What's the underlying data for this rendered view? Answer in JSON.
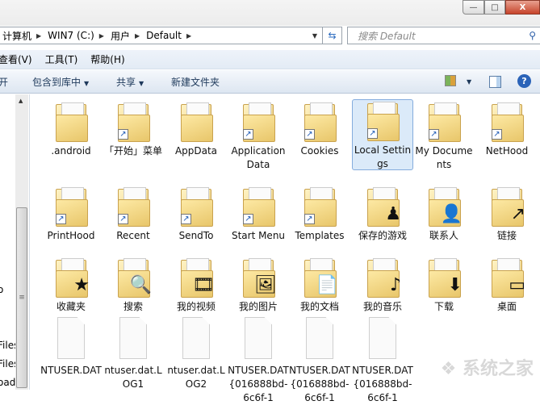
{
  "window": {
    "min": "—",
    "max": "□",
    "close": "X"
  },
  "address": {
    "crumbs": [
      "计算机",
      "WIN7 (C:)",
      "用户",
      "Default"
    ],
    "refresh_icon": "refresh-icon"
  },
  "search": {
    "placeholder": "搜索 Default",
    "icon": "🔍"
  },
  "menu": [
    "查看(V)",
    "工具(T)",
    "帮助(H)"
  ],
  "toolbar": {
    "open": "开",
    "include": "包含到库中",
    "share": "共享",
    "new_folder": "新建文件夹"
  },
  "nav": [
    "o",
    "Files",
    "Files",
    "oad"
  ],
  "items": [
    {
      "label": ".android",
      "kind": "folder"
    },
    {
      "label": "「开始」菜单",
      "kind": "shortcut"
    },
    {
      "label": "AppData",
      "kind": "folder"
    },
    {
      "label": "Application Data",
      "kind": "shortcut"
    },
    {
      "label": "Cookies",
      "kind": "shortcut"
    },
    {
      "label": "Local Settings",
      "kind": "shortcut",
      "selected": true
    },
    {
      "label": "My Documents",
      "kind": "shortcut"
    },
    {
      "label": "NetHood",
      "kind": "shortcut"
    },
    {
      "label": "PrintHood",
      "kind": "shortcut"
    },
    {
      "label": "Recent",
      "kind": "shortcut"
    },
    {
      "label": "SendTo",
      "kind": "shortcut"
    },
    {
      "label": "Start Menu",
      "kind": "shortcut"
    },
    {
      "label": "Templates",
      "kind": "shortcut"
    },
    {
      "label": "保存的游戏",
      "kind": "games"
    },
    {
      "label": "联系人",
      "kind": "contacts"
    },
    {
      "label": "链接",
      "kind": "links"
    },
    {
      "label": "收藏夹",
      "kind": "favorites"
    },
    {
      "label": "搜索",
      "kind": "search"
    },
    {
      "label": "我的视频",
      "kind": "videos"
    },
    {
      "label": "我的图片",
      "kind": "pictures"
    },
    {
      "label": "我的文档",
      "kind": "documents"
    },
    {
      "label": "我的音乐",
      "kind": "music"
    },
    {
      "label": "下载",
      "kind": "downloads"
    },
    {
      "label": "桌面",
      "kind": "desktop"
    },
    {
      "label": "NTUSER.DAT",
      "kind": "file"
    },
    {
      "label": "ntuser.dat.LOG1",
      "kind": "file"
    },
    {
      "label": "ntuser.dat.LOG2",
      "kind": "file"
    },
    {
      "label": "NTUSER.DAT{016888bd-6c6f-1",
      "kind": "file"
    },
    {
      "label": "NTUSER.DAT{016888bd-6c6f-1",
      "kind": "file"
    },
    {
      "label": "NTUSER.DAT{016888bd-6c6f-1",
      "kind": "file"
    }
  ],
  "watermark": "系统之家"
}
